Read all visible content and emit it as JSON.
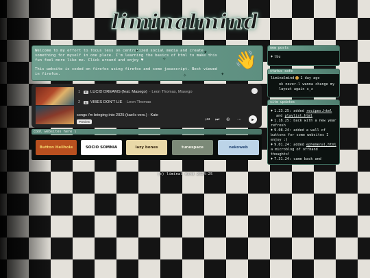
{
  "header": {
    "title": "liminalmind"
  },
  "intro": {
    "paragraphs": [
      "Welcome to my effort to focus less on centralized social media and create something for myself in one place. I'm learning the basics of html to make this fun feel more like me. Click around and enjoy ♥",
      "This website is coded on firefox using firefox and some javascript. Best viewed in firefox."
    ]
  },
  "player": {
    "tracks": [
      {
        "num": "1",
        "title": "LUCID DREAMS (feat. Masego)",
        "artist": "Leon Thomas, Masego"
      },
      {
        "num": "2",
        "title": "VIBES DON'T LIE",
        "artist": "Leon Thomas"
      }
    ],
    "explicit_label": "E",
    "now_playing": "songs i'm bringing into 2025 (kaei's vers.) · Kate",
    "preview_label": "Preview",
    "controls": {
      "prev": "⏮",
      "next": "⏭",
      "add": "⊕",
      "more": "⋯",
      "play": "▶"
    }
  },
  "cool_websites": {
    "label": "cool websites here ↴",
    "badges": [
      {
        "text": "Button Hellhole",
        "bg": "#b8501f",
        "fg": "#f3d36b"
      },
      {
        "text": "SOCIO SOMNIA",
        "bg": "#ffffff",
        "fg": "#111111"
      },
      {
        "text": "lazy bones",
        "bg": "#e9d9a8",
        "fg": "#3b2a14"
      },
      {
        "text": "tunespace",
        "bg": "#7c8a78",
        "fg": "#f2f2e8"
      },
      {
        "text": "nekoweb",
        "bg": "#bcd4e8",
        "fg": "#2a4c7a"
      }
    ]
  },
  "footer": {
    "text": "(c) liminal mind 2024-25"
  },
  "new_posts": {
    "header": "new posts",
    "items": [
      "tbu"
    ]
  },
  "status_cafe": {
    "header": "status cafe",
    "user": "liminalmind",
    "time": "1 day ago",
    "message": "ok never-l wanna change my layout again x_x"
  },
  "site_updates": {
    "header": "site updates",
    "items": [
      {
        "date": "1.23.25:",
        "text": "added",
        "link": "recipes.html",
        "rest": ""
      },
      {
        "date": "",
        "text": "and",
        "link": "playlist.html",
        "rest": ""
      },
      {
        "date": "1.18.25:",
        "text": "back with a new year refresh",
        "link": "",
        "rest": ""
      },
      {
        "date": "9.08.24:",
        "text": "added a wall of buttons for some websites I enjoy :)",
        "link": "",
        "rest": ""
      },
      {
        "date": "9.01.24:",
        "text": "added",
        "link": "ephemeral.html",
        "rest": "a microblog of offhand thoughts!"
      },
      {
        "date": "7.31.24:",
        "text": "came back and",
        "link": "",
        "rest": ""
      }
    ]
  },
  "colors": {
    "accent": "#6e9f8f",
    "panel": "#0b1210",
    "border": "#3e6b5c"
  }
}
